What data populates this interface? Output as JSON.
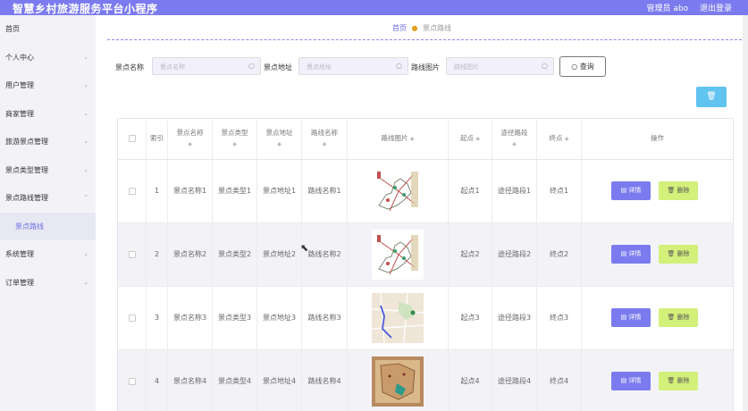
{
  "app": {
    "title": "智慧乡村旅游服务平台小程序",
    "user": "管理员 abo",
    "logout": "退出登录"
  },
  "sidebar": {
    "items": [
      {
        "label": "首页",
        "chev": ""
      },
      {
        "label": "个人中心",
        "chev": "⌄"
      },
      {
        "label": "用户管理",
        "chev": "⌄"
      },
      {
        "label": "商家管理",
        "chev": "⌄"
      },
      {
        "label": "旅游景点管理",
        "chev": "⌄"
      },
      {
        "label": "景点类型管理",
        "chev": "⌄"
      },
      {
        "label": "景点路线管理",
        "chev": "⌃"
      },
      {
        "label": "景点路线",
        "chev": ""
      },
      {
        "label": "系统管理",
        "chev": "⌄"
      },
      {
        "label": "订单管理",
        "chev": "⌄"
      }
    ]
  },
  "breadcrumb": {
    "home": "首页",
    "current": "景点路线"
  },
  "search": {
    "name_label": "景点名称",
    "name_placeholder": "景点名称",
    "addr_label": "景点地址",
    "addr_placeholder": "景点地址",
    "pic_label": "路线图片",
    "pic_placeholder": "路线图片",
    "button": "查询"
  },
  "table": {
    "headers": [
      "索引",
      "景点名称",
      "景点类型",
      "景点地址",
      "路线名称",
      "路线图片",
      "起点",
      "途径路段",
      "终点",
      "操作"
    ],
    "rows": [
      {
        "idx": "1",
        "name": "景点名称1",
        "type": "景点类型1",
        "addr": "景点地址1",
        "route": "路线名称1",
        "start": "起点1",
        "via": "途径路段1",
        "end": "终点1"
      },
      {
        "idx": "2",
        "name": "景点名称2",
        "type": "景点类型2",
        "addr": "景点地址2",
        "route": "路线名称2",
        "start": "起点2",
        "via": "途径路段2",
        "end": "终点2"
      },
      {
        "idx": "3",
        "name": "景点名称3",
        "type": "景点类型3",
        "addr": "景点地址3",
        "route": "路线名称3",
        "start": "起点3",
        "via": "途径路段3",
        "end": "终点3"
      },
      {
        "idx": "4",
        "name": "景点名称4",
        "type": "景点类型4",
        "addr": "景点地址4",
        "route": "路线名称4",
        "start": "起点4",
        "via": "途径路段4",
        "end": "终点4"
      }
    ],
    "view_label": "详情",
    "delete_label": "删除"
  },
  "colors": {
    "primary": "#7b7bef",
    "accent_delete": "#d2f07a",
    "top_delete": "#61c3f0"
  },
  "icons": {
    "search": "search-icon",
    "view": "file-icon",
    "delete": "trash-icon"
  }
}
